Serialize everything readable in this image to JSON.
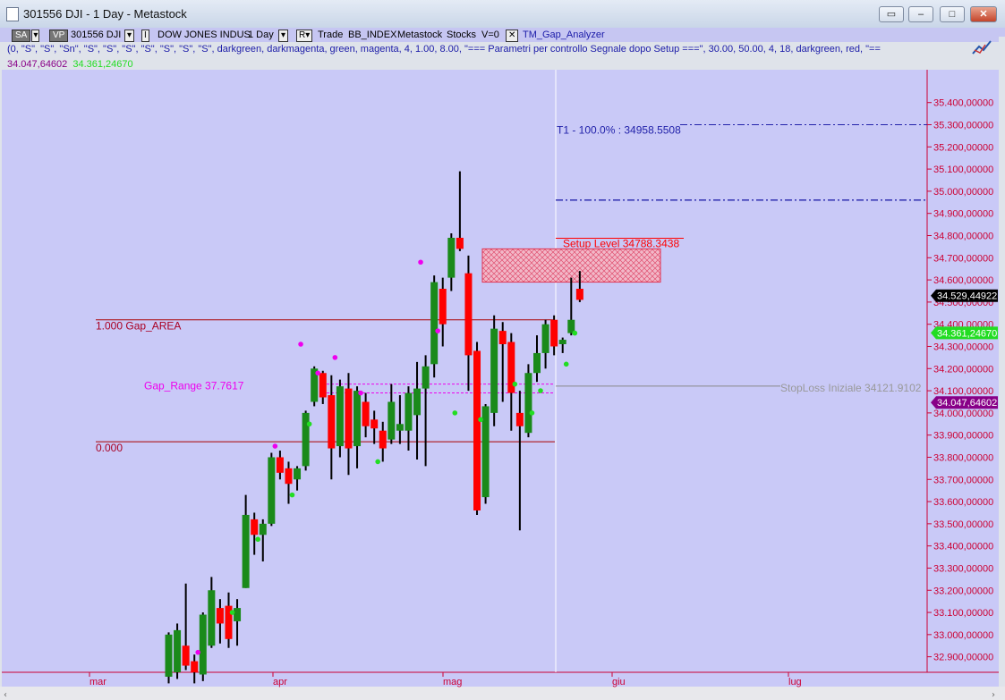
{
  "window": {
    "title": "301556 DJI - 1 Day - Metastock",
    "buttons": [
      "▭",
      "–",
      "□",
      "✕"
    ]
  },
  "toolbar": {
    "sa_label": "SA",
    "vp_label": "VP",
    "symbol": "301556 DJI",
    "name": "DOW JONES INDUS",
    "period": "1 Day",
    "trade_label": "Trade",
    "index_label": "BB_INDEX",
    "source_label": "Metastock",
    "type_label": "Stocks",
    "volume_label": "V=0",
    "indicator_name": "TM_Gap_Analyzer",
    "i_label": "I",
    "r_label": "R",
    "dropdown_glyph": "▾",
    "close_glyph": "✕"
  },
  "params_line": "(0, \"S\", \"S\", \"Sn\", \"S\", \"S\", \"S\", \"S\", \"S\", \"S\", \"S\", darkgreen, darkmagenta, green, magenta, 4, 1.00, 8.00, \"=== Parametri per controllo Segnale dopo Setup ===\", 30.00, 50.00, 4, 18, darkgreen, red, \"==",
  "values_line": {
    "v1": "34.047,64602",
    "v2": "34.361,24670"
  },
  "colors": {
    "chart_bg": "#c9c9f7",
    "up_candle": "#1a8a1a",
    "down_candle": "#ff0000",
    "axis": "#cc0033",
    "grid": "#aa0000",
    "magenta": "#ee00ee",
    "green_dot": "#22dd22"
  },
  "chart_data": {
    "type": "candlestick",
    "y_range": [
      32830,
      35540
    ],
    "y_ticks": [
      "35.400,00000",
      "35.300,00000",
      "35.200,00000",
      "35.100,00000",
      "35.000,00000",
      "34.900,00000",
      "34.800,00000",
      "34.700,00000",
      "34.600,00000",
      "34.500,00000",
      "34.400,00000",
      "34.300,00000",
      "34.200,00000",
      "34.100,00000",
      "34.000,00000",
      "33.900,00000",
      "33.800,00000",
      "33.700,00000",
      "33.600,00000",
      "33.500,00000",
      "33.400,00000",
      "33.300,00000",
      "33.200,00000",
      "33.100,00000",
      "33.000,00000",
      "32.900,00000"
    ],
    "x_labels": [
      "mar",
      "apr",
      "mag",
      "giu",
      "lug"
    ],
    "price_tags": [
      {
        "label": "34.529,44922",
        "price": 34529,
        "bg": "#000000",
        "fg": "#ffffff"
      },
      {
        "label": "34.361,24670",
        "price": 34361,
        "bg": "#22dd22",
        "fg": "#ffffff"
      },
      {
        "label": "34.047,64602",
        "price": 34047,
        "bg": "#880088",
        "fg": "#ffffff"
      }
    ],
    "annotations": {
      "t1": "T1 - 100.0% : 34958.5508",
      "setup": "Setup Level 34788.3438",
      "gap_area": "1.000 Gap_AREA",
      "zero_level": "0.000",
      "gap_range": "Gap_Range 37.7617",
      "stoploss": "StopLoss Iniziale 34121.9102"
    },
    "levels": {
      "t1": 35300,
      "t1b": 34960,
      "setup": 34788,
      "setup_box": [
        34590,
        34740
      ],
      "gap_top": 34420,
      "gap_bottom": 33870,
      "gap_range": [
        34090,
        34130
      ],
      "stoploss": 34121
    },
    "candles": [
      {
        "i": 0,
        "o": 32810,
        "h": 33010,
        "l": 32780,
        "c": 33000
      },
      {
        "i": 1,
        "o": 32830,
        "h": 33050,
        "l": 32800,
        "c": 33020
      },
      {
        "i": 2,
        "o": 32950,
        "h": 33230,
        "l": 32840,
        "c": 32860
      },
      {
        "i": 3,
        "o": 32880,
        "h": 32910,
        "l": 32780,
        "c": 32830
      },
      {
        "i": 4,
        "o": 32820,
        "h": 33100,
        "l": 32790,
        "c": 33090
      },
      {
        "i": 5,
        "o": 32950,
        "h": 33260,
        "l": 32940,
        "c": 33200
      },
      {
        "i": 6,
        "o": 33120,
        "h": 33160,
        "l": 32960,
        "c": 33050
      },
      {
        "i": 7,
        "o": 33130,
        "h": 33190,
        "l": 32940,
        "c": 32980
      },
      {
        "i": 8,
        "o": 33060,
        "h": 33160,
        "l": 32950,
        "c": 33120
      },
      {
        "i": 9,
        "o": 33210,
        "h": 33630,
        "l": 33210,
        "c": 33540
      },
      {
        "i": 10,
        "o": 33520,
        "h": 33550,
        "l": 33360,
        "c": 33450
      },
      {
        "i": 11,
        "o": 33450,
        "h": 33520,
        "l": 33330,
        "c": 33500
      },
      {
        "i": 12,
        "o": 33500,
        "h": 33820,
        "l": 33490,
        "c": 33800
      },
      {
        "i": 13,
        "o": 33800,
        "h": 33830,
        "l": 33700,
        "c": 33730
      },
      {
        "i": 14,
        "o": 33750,
        "h": 33780,
        "l": 33590,
        "c": 33680
      },
      {
        "i": 15,
        "o": 33700,
        "h": 33760,
        "l": 33650,
        "c": 33750
      },
      {
        "i": 16,
        "o": 33760,
        "h": 34010,
        "l": 33740,
        "c": 34000
      },
      {
        "i": 17,
        "o": 34050,
        "h": 34210,
        "l": 34030,
        "c": 34200
      },
      {
        "i": 18,
        "o": 34180,
        "h": 34190,
        "l": 34040,
        "c": 34070
      },
      {
        "i": 19,
        "o": 34080,
        "h": 34170,
        "l": 33700,
        "c": 33840
      },
      {
        "i": 20,
        "o": 33850,
        "h": 34150,
        "l": 33800,
        "c": 34120
      },
      {
        "i": 21,
        "o": 34110,
        "h": 34180,
        "l": 33720,
        "c": 33840
      },
      {
        "i": 22,
        "o": 33850,
        "h": 34120,
        "l": 33750,
        "c": 34100
      },
      {
        "i": 23,
        "o": 34050,
        "h": 34090,
        "l": 33890,
        "c": 33940
      },
      {
        "i": 24,
        "o": 33970,
        "h": 34010,
        "l": 33860,
        "c": 33930
      },
      {
        "i": 25,
        "o": 33920,
        "h": 33960,
        "l": 33780,
        "c": 33840
      },
      {
        "i": 26,
        "o": 33880,
        "h": 34130,
        "l": 33860,
        "c": 34050
      },
      {
        "i": 27,
        "o": 33920,
        "h": 34080,
        "l": 33860,
        "c": 33950
      },
      {
        "i": 28,
        "o": 33920,
        "h": 34120,
        "l": 33830,
        "c": 34090
      },
      {
        "i": 29,
        "o": 33990,
        "h": 34230,
        "l": 33790,
        "c": 34110
      },
      {
        "i": 30,
        "o": 34110,
        "h": 34260,
        "l": 33760,
        "c": 34210
      },
      {
        "i": 31,
        "o": 34220,
        "h": 34620,
        "l": 34160,
        "c": 34590
      },
      {
        "i": 32,
        "o": 34560,
        "h": 34610,
        "l": 34300,
        "c": 34400
      },
      {
        "i": 33,
        "o": 34610,
        "h": 34810,
        "l": 34550,
        "c": 34790
      },
      {
        "i": 34,
        "o": 34790,
        "h": 35090,
        "l": 34730,
        "c": 34740
      },
      {
        "i": 35,
        "o": 34630,
        "h": 34710,
        "l": 34100,
        "c": 34260
      },
      {
        "i": 36,
        "o": 34280,
        "h": 34320,
        "l": 33540,
        "c": 33560
      },
      {
        "i": 37,
        "o": 33620,
        "h": 34040,
        "l": 33590,
        "c": 34030
      },
      {
        "i": 38,
        "o": 34000,
        "h": 34440,
        "l": 33940,
        "c": 34380
      },
      {
        "i": 39,
        "o": 34370,
        "h": 34410,
        "l": 34050,
        "c": 34310
      },
      {
        "i": 40,
        "o": 34320,
        "h": 34360,
        "l": 33920,
        "c": 34090
      },
      {
        "i": 41,
        "o": 34000,
        "h": 34100,
        "l": 33470,
        "c": 33940
      },
      {
        "i": 42,
        "o": 33910,
        "h": 34220,
        "l": 33890,
        "c": 34180
      },
      {
        "i": 43,
        "o": 34180,
        "h": 34350,
        "l": 34140,
        "c": 34270
      },
      {
        "i": 44,
        "o": 34270,
        "h": 34420,
        "l": 34200,
        "c": 34400
      },
      {
        "i": 45,
        "o": 34420,
        "h": 34440,
        "l": 34260,
        "c": 34300
      },
      {
        "i": 46,
        "o": 34310,
        "h": 34340,
        "l": 34270,
        "c": 34330
      },
      {
        "i": 47,
        "o": 34360,
        "h": 34610,
        "l": 34350,
        "c": 34420
      },
      {
        "i": 48,
        "o": 34560,
        "h": 34640,
        "l": 34500,
        "c": 34510
      }
    ],
    "dots": [
      {
        "i": 3,
        "p": 32920,
        "c": "magenta"
      },
      {
        "i": 7,
        "p": 33100,
        "c": "green_dot"
      },
      {
        "i": 10,
        "p": 33430,
        "c": "green_dot"
      },
      {
        "i": 12,
        "p": 33850,
        "c": "magenta"
      },
      {
        "i": 14,
        "p": 33630,
        "c": "green_dot"
      },
      {
        "i": 15,
        "p": 34310,
        "c": "magenta"
      },
      {
        "i": 16,
        "p": 33950,
        "c": "green_dot"
      },
      {
        "i": 17,
        "p": 34180,
        "c": "magenta"
      },
      {
        "i": 19,
        "p": 34250,
        "c": "magenta"
      },
      {
        "i": 22,
        "p": 34090,
        "c": "magenta"
      },
      {
        "i": 24,
        "p": 33780,
        "c": "green_dot"
      },
      {
        "i": 29,
        "p": 34680,
        "c": "magenta"
      },
      {
        "i": 31,
        "p": 34370,
        "c": "magenta"
      },
      {
        "i": 33,
        "p": 34000,
        "c": "green_dot"
      },
      {
        "i": 36,
        "p": 33970,
        "c": "green_dot"
      },
      {
        "i": 40,
        "p": 34130,
        "c": "green_dot"
      },
      {
        "i": 42,
        "p": 34000,
        "c": "green_dot"
      },
      {
        "i": 43,
        "p": 34100,
        "c": "green_dot"
      },
      {
        "i": 46,
        "p": 34220,
        "c": "green_dot"
      },
      {
        "i": 47,
        "p": 34360,
        "c": "green_dot"
      }
    ]
  }
}
